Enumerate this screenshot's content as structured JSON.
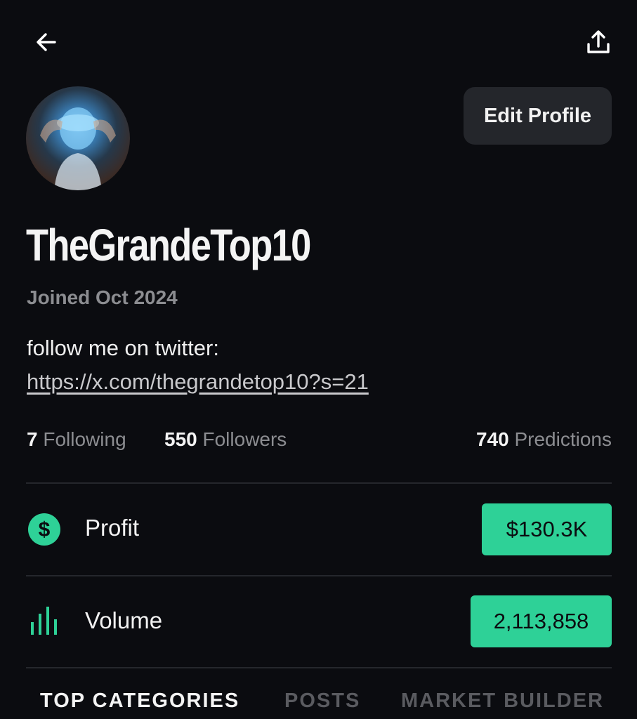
{
  "header": {
    "back_icon": "arrow-left-icon",
    "share_icon": "share-upload-icon"
  },
  "profile": {
    "avatar_alt": "avatar",
    "edit_label": "Edit Profile",
    "username": "TheGrandeTop10",
    "joined": "Joined Oct 2024",
    "bio_text": "follow me on twitter: ",
    "bio_link": "https://x.com/thegrandetop10?s=21"
  },
  "stats": {
    "following_count": "7",
    "following_label": "Following",
    "followers_count": "550",
    "followers_label": "Followers",
    "predictions_count": "740",
    "predictions_label": "Predictions"
  },
  "metrics": {
    "profit": {
      "label": "Profit",
      "value": "$130.3K",
      "icon": "dollar-circle-icon"
    },
    "volume": {
      "label": "Volume",
      "value": "2,113,858",
      "icon": "bar-chart-icon"
    }
  },
  "colors": {
    "background": "#0b0c10",
    "accent": "#2ed197",
    "muted_text": "#8c8d91"
  },
  "tabs": [
    {
      "label": "TOP CATEGORIES",
      "active": true
    },
    {
      "label": "POSTS",
      "active": false
    },
    {
      "label": "MARKET BUILDER",
      "active": false
    }
  ]
}
